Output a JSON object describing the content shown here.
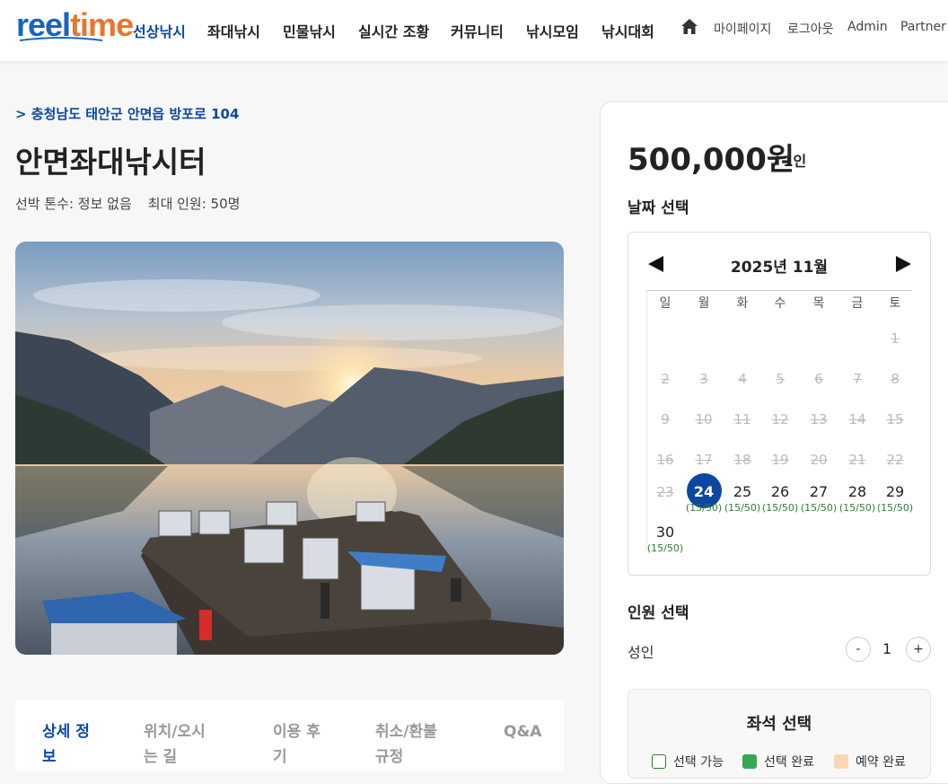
{
  "header": {
    "logo_reel": "reel",
    "logo_time": "time",
    "nav": [
      "선상낚시",
      "좌대낚시",
      "민물낚시",
      "실시간 조황",
      "커뮤니티",
      "낚시모임",
      "낚시대회"
    ],
    "util": [
      "마이페이지",
      "로그아웃",
      "Admin",
      "Partner"
    ]
  },
  "listing": {
    "address": "> 충청남도 태안군 안면읍 방포로 104",
    "title": "안면좌대낚시터",
    "tonnage": "선박 톤수: 정보 없음",
    "capacity": "최대 인원: 50명"
  },
  "tabs": [
    {
      "line1": "상세 정",
      "line2": "보"
    },
    {
      "line1": "위치/오시",
      "line2": "는 길"
    },
    {
      "line1": "이용 후",
      "line2": "기"
    },
    {
      "line1": "취소/환불",
      "line2": "규정"
    },
    {
      "line1": "Q&A",
      "line2": ""
    }
  ],
  "booking": {
    "price": "500,000원",
    "per": "/ 1인",
    "date_label": "날짜 선택",
    "people_label": "인원 선택",
    "adult_label": "성인",
    "minus": "-",
    "plus": "+",
    "qty": "1",
    "seat_title": "좌석 선택",
    "legend": [
      "선택 가능",
      "선택 완료",
      "예약 완료"
    ]
  },
  "calendar": {
    "title": "2025년 11월",
    "dow": [
      "일",
      "월",
      "화",
      "수",
      "목",
      "금",
      "토"
    ],
    "selected_day": "24",
    "count": "(15/50)",
    "weeks": [
      [
        "",
        "",
        "",
        "",
        "",
        "",
        "1"
      ],
      [
        "2",
        "3",
        "4",
        "5",
        "6",
        "7",
        "8"
      ],
      [
        "9",
        "10",
        "11",
        "12",
        "13",
        "14",
        "15"
      ],
      [
        "16",
        "17",
        "18",
        "19",
        "20",
        "21",
        "22"
      ],
      [
        "23",
        "24",
        "25",
        "26",
        "27",
        "28",
        "29"
      ],
      [
        "30",
        "",
        "",
        "",
        "",
        "",
        ""
      ]
    ],
    "available_days": [
      "24",
      "25",
      "26",
      "27",
      "28",
      "29",
      "30"
    ]
  },
  "colors": {
    "primary": "#0d47a1",
    "available": "#2e7d32",
    "reserved": "#ffd6b0"
  }
}
